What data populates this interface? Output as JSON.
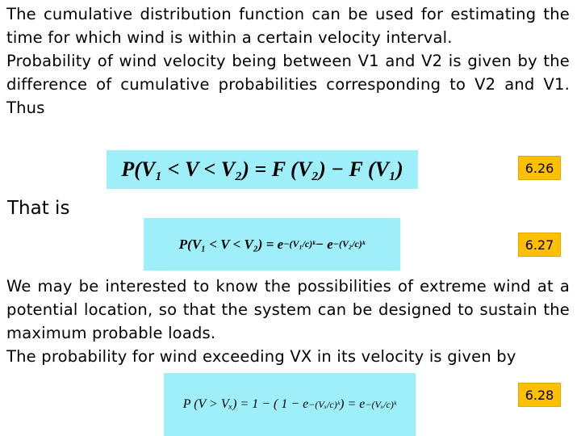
{
  "paragraph1": [
    "The cumulative distribution function can be used for estimating the time for which wind is within a certain velocity interval.",
    "Probability of wind velocity being between V1 and V2 is given by the difference of cumulative probabilities corresponding to V2 and V1. Thus"
  ],
  "that_is": "That is",
  "paragraph2": [
    "We may be interested to know the possibilities of extreme wind at a potential location, so that the system can be designed to sustain the maximum probable loads.",
    "The probability for wind exceeding VX in its velocity is given by"
  ],
  "equations": [
    {
      "lhs": "P(V₁ < V < V₂) = F (V₂) − F (V₁)",
      "label": "6.26"
    },
    {
      "lhs": "P(V₁ < V < V₂) =  e",
      "exp1": "−(V₁/c)ᵏ",
      "mid": " − e",
      "exp2": "−(V₂/c)ᵏ",
      "label": "6.27"
    },
    {
      "lhs": "P (V > Vₓ) = 1 − ( 1 − e",
      "exp1": "−(Vₓ/c)ᵏ",
      "mid": " ) = e",
      "exp2": "−(Vₓ/c)ᵏ",
      "label": "6.28"
    }
  ],
  "colors": {
    "equation_bg": "#9feffa",
    "label_bg": "#ffc000"
  }
}
